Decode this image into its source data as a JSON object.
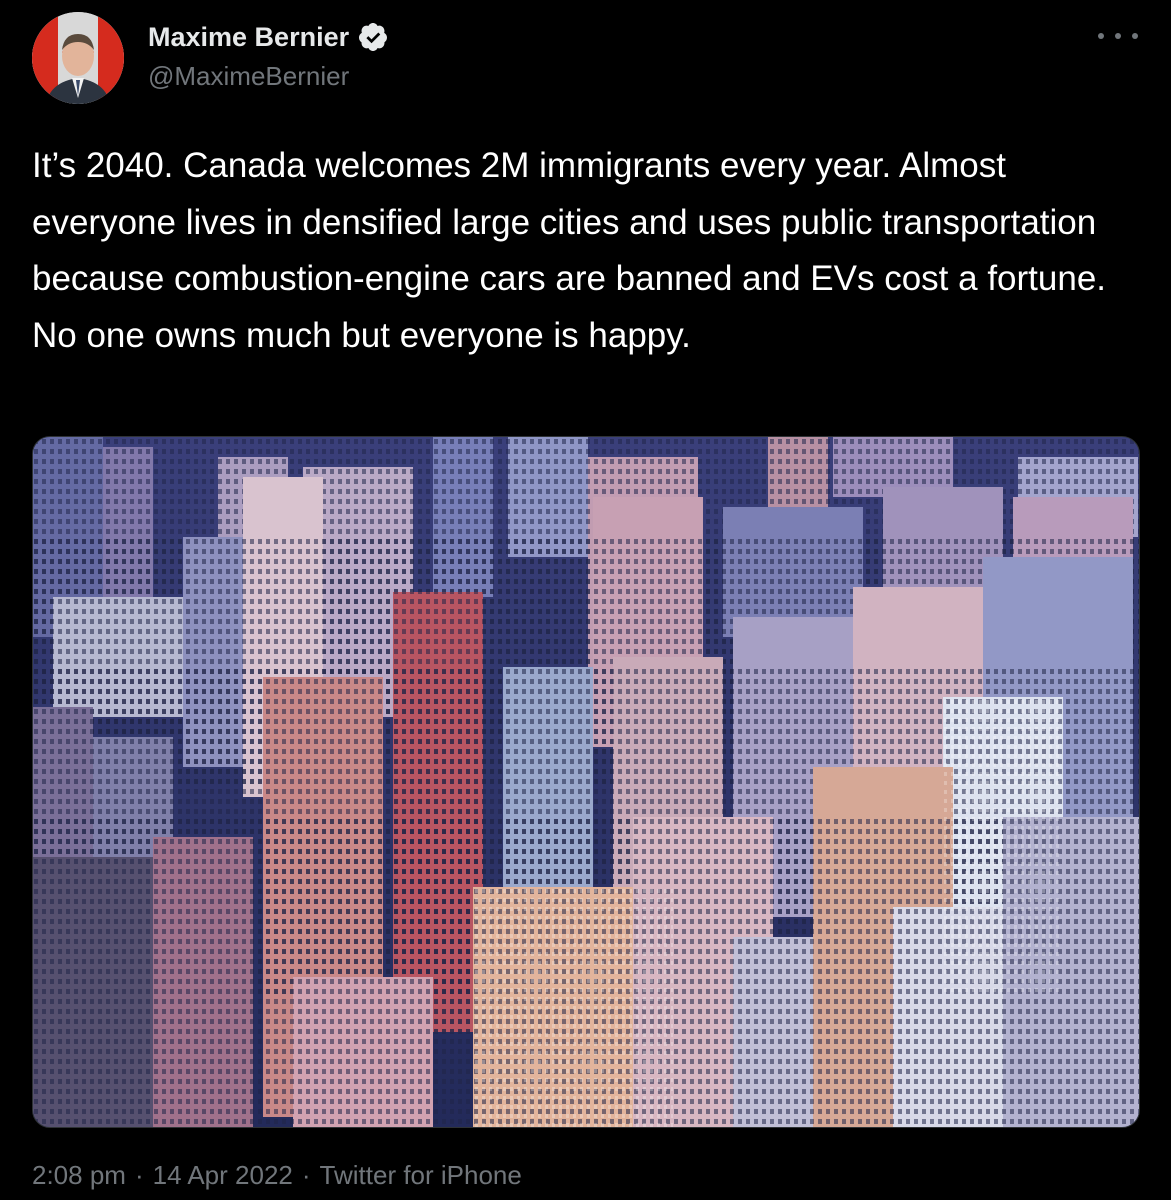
{
  "author": {
    "name": "Maxime Bernier",
    "handle": "@MaximeBernier",
    "verified": true
  },
  "icons": {
    "avatar": "avatar-portrait",
    "verified": "verified-badge-icon",
    "more": "more-options-icon"
  },
  "tweet": {
    "text": "It’s 2040. Canada welcomes 2M immigrants every year. Almost everyone lives in densified large cities and uses public transportation because combustion-engine cars are banned and EVs cost a fortune. No one owns much but everyone is happy."
  },
  "media": {
    "alt_kind": "photo of dense high-rise residential towers"
  },
  "meta": {
    "time": "2:08 pm",
    "separator": "·",
    "date": "14 Apr 2022",
    "source": "Twitter for iPhone"
  },
  "colors": {
    "background": "#000000",
    "text": "#ffffff",
    "secondary": "#71767b",
    "verified_badge": "#e7e9ea"
  }
}
